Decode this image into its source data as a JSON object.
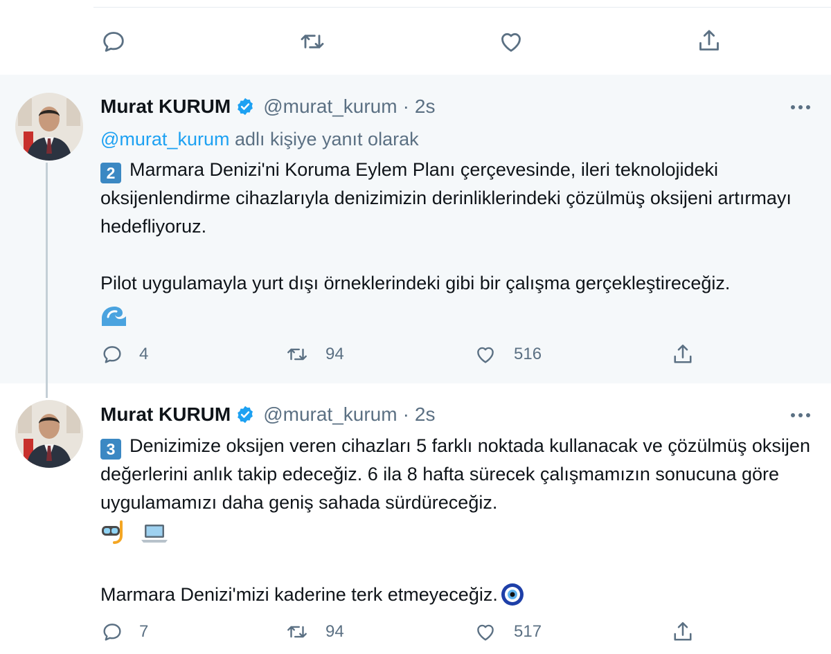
{
  "colors": {
    "accent": "#1da1f2",
    "muted": "#5b7083",
    "keycap": "#3b88c3",
    "background_highlight": "#f5f8fa"
  },
  "top_actions": [
    "reply-icon",
    "retweet-icon",
    "like-icon",
    "share-icon"
  ],
  "tweets": [
    {
      "name": "Murat KURUM",
      "handle": "@murat_kurum",
      "dot": "·",
      "time": "2s",
      "reply_prefix": "@murat_kurum",
      "reply_suffix": " adlı kişiye yanıt olarak",
      "keycap": "2",
      "para1": "Marmara Denizi'ni Koruma Eylem Planı çerçevesinde, ileri teknolojideki oksijenlendirme cihazlarıyla denizimizin derinliklerindeki çözülmüş oksijeni artırmayı hedefliyoruz.",
      "para2": "Pilot uygulamayla yurt dışı örneklerindeki gibi bir çalışma gerçekleştireceğiz.",
      "emoji": "water-wave-icon",
      "replies": "4",
      "retweets": "94",
      "likes": "516"
    },
    {
      "name": "Murat KURUM",
      "handle": "@murat_kurum",
      "dot": "·",
      "time": "2s",
      "keycap": "3",
      "para1": "Denizimize oksijen veren cihazları 5 farklı noktada kullanacak ve çözülmüş oksijen değerlerini anlık takip edeceğiz. 6 ila 8 hafta sürecek çalışmamızın sonucuna göre uygulamamızı daha geniş sahada sürdüreceğiz.",
      "emojis": [
        "diving-mask-icon",
        "laptop-icon"
      ],
      "para2": "Marmara Denizi'mizi kaderine terk etmeyeceğiz.",
      "emoji_end": "nazar-amulet-icon",
      "replies": "7",
      "retweets": "94",
      "likes": "517"
    }
  ]
}
